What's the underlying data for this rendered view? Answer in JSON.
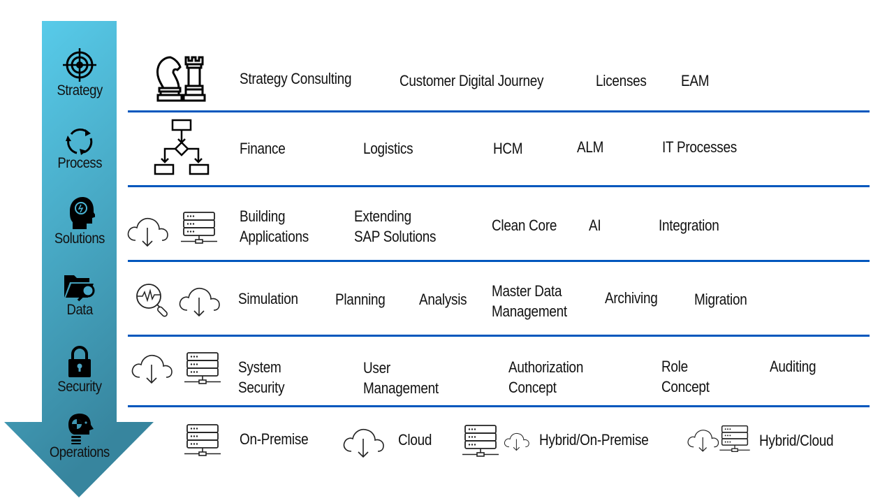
{
  "colors": {
    "arrow_top": "#5ad0ef",
    "arrow_bottom": "#3a8ca6",
    "separator": "#0057bd"
  },
  "stages": [
    {
      "label": "Strategy",
      "icon": "target-icon"
    },
    {
      "label": "Process",
      "icon": "refresh-cycle-icon"
    },
    {
      "label": "Solutions",
      "icon": "head-lightbulb-icon"
    },
    {
      "label": "Data",
      "icon": "folder-search-icon"
    },
    {
      "label": "Security",
      "icon": "padlock-icon"
    },
    {
      "label": "Operations",
      "icon": "head-gear-icon"
    }
  ],
  "rows": [
    {
      "name": "strategy",
      "icons": [
        "chess-pieces-icon"
      ],
      "items": [
        "Strategy Consulting",
        "Customer Digital Journey",
        "Licenses",
        "EAM"
      ]
    },
    {
      "name": "process",
      "icons": [
        "flowchart-icon"
      ],
      "items": [
        "Finance",
        "Logistics",
        "HCM",
        "ALM",
        "IT Processes"
      ]
    },
    {
      "name": "solutions",
      "icons": [
        "cloud-download-icon",
        "server-icon"
      ],
      "items": [
        "Building\nApplications",
        "Extending\nSAP Solutions",
        "Clean Core",
        "AI",
        "Integration"
      ]
    },
    {
      "name": "data",
      "icons": [
        "analysis-magnifier-icon",
        "cloud-download-icon"
      ],
      "items": [
        "Simulation",
        "Planning",
        "Analysis",
        "Master Data\nManagement",
        "Archiving",
        "Migration"
      ]
    },
    {
      "name": "security",
      "icons": [
        "cloud-download-icon",
        "server-icon"
      ],
      "items": [
        "System\nSecurity",
        "User\nManagement",
        "Authorization\nConcept",
        "Role\nConcept",
        "Auditing"
      ]
    },
    {
      "name": "operations",
      "icons": [],
      "items": [
        "On-Premise",
        "Cloud",
        "Hybrid/On-Premise",
        "Hybrid/Cloud"
      ]
    }
  ]
}
